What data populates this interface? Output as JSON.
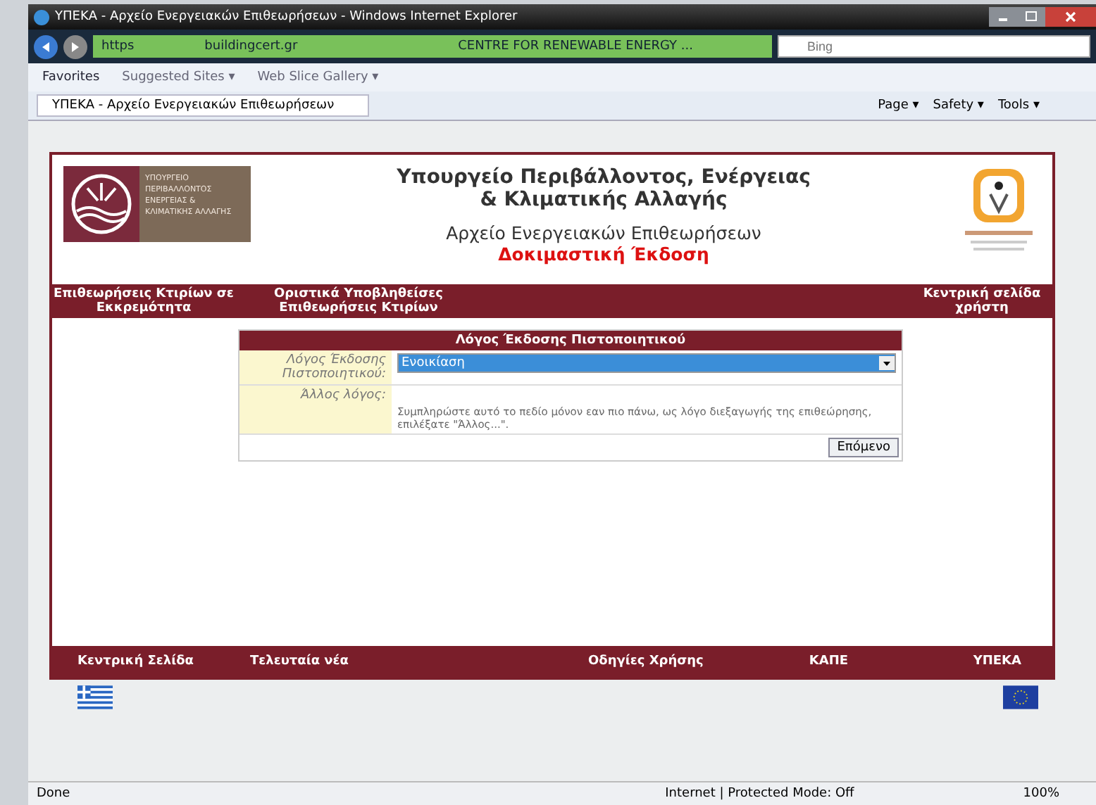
{
  "window": {
    "title": "ΥΠΕΚΑ - Αρχείο Ενεργειακών Επιθεωρήσεων - Windows Internet Explorer"
  },
  "address_bar": {
    "protocol": "https",
    "domain": "buildingcert.gr",
    "certificate": "CENTRE FOR RENEWABLE ENERGY ...",
    "search_placeholder": "Bing"
  },
  "favorites_bar": [
    "Favorites",
    "Suggested Sites ▾",
    "Web Slice Gallery ▾"
  ],
  "tab": {
    "title": "ΥΠΕΚΑ - Αρχείο Ενεργειακών Επιθεωρήσεων"
  },
  "command_bar": [
    "Page ▾",
    "Safety ▾",
    "Tools ▾"
  ],
  "page": {
    "logo_text": "ΥΠΟΥΡΓΕΙΟ ΠΕΡΙΒΑΛΛΟΝΤΟΣ ΕΝΕΡΓΕΙΑΣ & ΚΛΙΜΑΤΙΚΗΣ ΑΛΛΑΓΗΣ",
    "title_lines": [
      "Υπουργείο Περιβάλλοντος, Ενέργειας",
      "& Κλιματικής Αλλαγής"
    ],
    "subtitle": "Αρχείο Ενεργειακών Επιθεωρήσεων",
    "edition": "Δοκιμαστική Έκδοση",
    "nav": [
      "Επιθεωρήσεις Κτιρίων σε Εκκρεμότητα",
      "Οριστικά Υποβληθείσες Επιθεωρήσεις Κτιρίων",
      "Κεντρική σελίδα χρήστη"
    ],
    "form": {
      "heading": "Λόγος Έκδοσης Πιστοποιητικού",
      "reason_label": "Λόγος Έκδοσης Πιστοποιητικού:",
      "reason_value": "Ενοικίαση",
      "other_label": "Άλλος λόγος:",
      "other_hint": "Συμπληρώστε αυτό το πεδίο μόνον εαν πιο πάνω, ως λόγο διεξαγωγής της επιθεώρησης, επιλέξατε \"Άλλος...\".",
      "next_button": "Επόμενο"
    },
    "footer_nav": [
      "Κεντρική Σελίδα",
      "Τελευταία νέα",
      "Οδηγίες Χρήσης",
      "ΚΑΠΕ",
      "ΥΠΕΚΑ"
    ]
  },
  "status_bar": {
    "text": "Done",
    "zone": "Internet | Protected Mode: Off",
    "zoom": "100%"
  }
}
